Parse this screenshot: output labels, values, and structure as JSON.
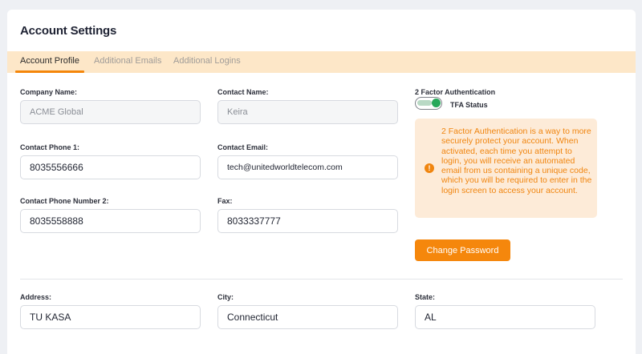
{
  "header": {
    "title": "Account Settings"
  },
  "tabs": [
    {
      "label": "Account Profile"
    },
    {
      "label": "Additional Emails"
    },
    {
      "label": "Additional Logins"
    }
  ],
  "fields": {
    "company_name": {
      "label": "Company Name:",
      "value": "ACME Global"
    },
    "contact_name": {
      "label": "Contact Name:",
      "value": "Keira"
    },
    "contact_phone_1": {
      "label": "Contact Phone 1:",
      "value": "8035556666"
    },
    "contact_email": {
      "label": "Contact Email:",
      "value": "tech@unitedworldtelecom.com"
    },
    "contact_phone_2": {
      "label": "Contact Phone Number 2:",
      "value": "8035558888"
    },
    "fax": {
      "label": "Fax:",
      "value": "8033337777"
    },
    "address": {
      "label": "Address:",
      "value": "TU KASA"
    },
    "city": {
      "label": "City:",
      "value": "Connecticut"
    },
    "state": {
      "label": "State:",
      "value": "AL"
    }
  },
  "tfa": {
    "heading": "2 Factor Authentication",
    "status_label": "TFA Status",
    "enabled": true,
    "info_icon": "exclamation-circle-icon",
    "info": "2 Factor Authentication is a way to more securely protect your account. When activated, each time you attempt to login, you will receive an automated email from us containing a unique code, which you will be required to enter in the login screen to access your account."
  },
  "actions": {
    "change_password": "Change Password"
  },
  "colors": {
    "accent": "#f5870c",
    "tab_bar": "#fde7c8",
    "info_bg": "#fdebd8",
    "toggle_on": "#27a85a"
  }
}
